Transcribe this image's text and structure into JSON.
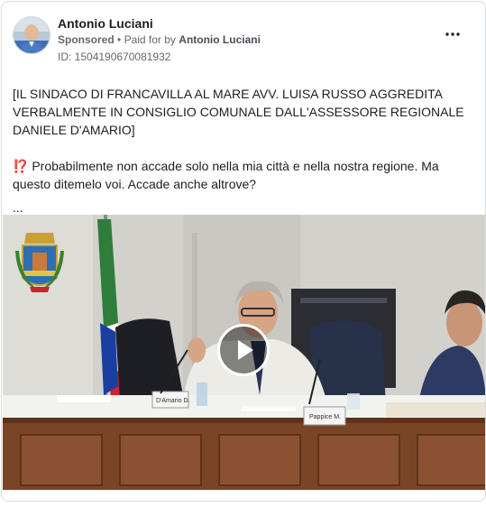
{
  "post": {
    "author_name": "Antonio Luciani",
    "sponsored_label": "Sponsored",
    "separator": "•",
    "paid_for_prefix": "Paid for by",
    "paid_for_name": "Antonio Luciani",
    "library_id": "ID: 1504190670081932",
    "more_options_icon": "more-horizontal-icon",
    "paragraph_1": "[IL SINDACO DI FRANCAVILLA AL MARE AVV. LUISA RUSSO AGGREDITA VERBALMENTE IN CONSIGLIO COMUNALE DALL'ASSESSORE REGIONALE DANIELE D'AMARIO]",
    "paragraph_2": "⁉️ Probabilmente non accade solo nella mia città e nella nostra regione. Ma questo ditemelo voi. Accade anche altrove?",
    "see_more": "..."
  },
  "video": {
    "play_icon": "play-icon",
    "nameplate_left": "D'Amario D.",
    "nameplate_right": "Pappice M."
  },
  "colors": {
    "primary_text": "#1c1e21",
    "secondary_text": "#65676b",
    "border": "#dadde1"
  }
}
